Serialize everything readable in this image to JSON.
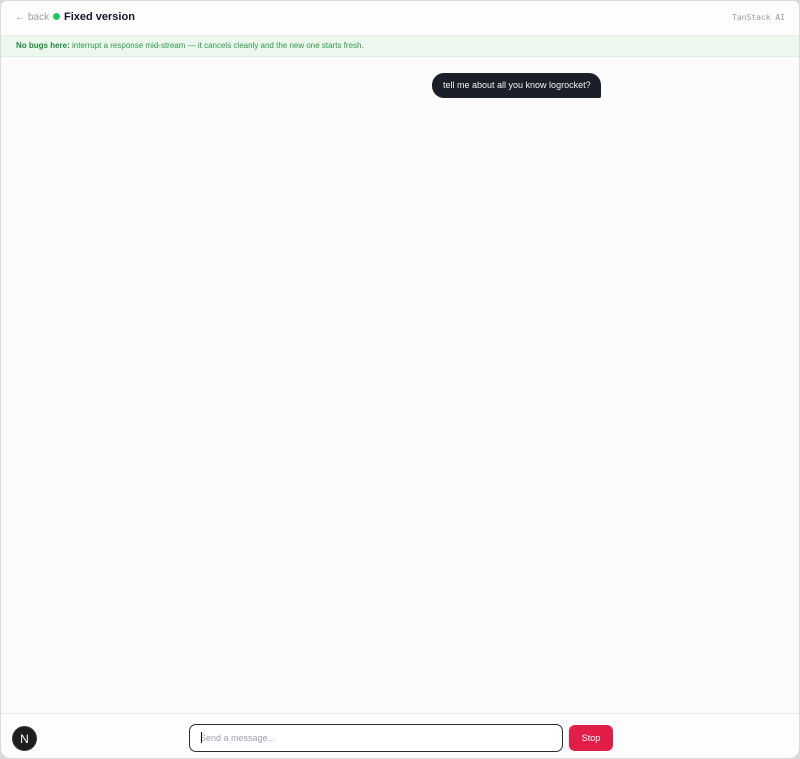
{
  "header": {
    "back_label": "back",
    "back_icon": "arrow-left-icon",
    "title": "Fixed version",
    "status_color": "#22c55e",
    "brand": "TanStack AI"
  },
  "banner": {
    "lead": "No bugs here:",
    "text": "interrupt a response mid-stream — it cancels cleanly and the new one starts fresh."
  },
  "messages": [
    {
      "role": "user",
      "text": "tell me about all you know logrocket?"
    }
  ],
  "footer": {
    "avatar_letter": "N",
    "input_placeholder": "Send a message...",
    "input_value": "",
    "stop_label": "Stop",
    "stop_color": "#e11d48"
  }
}
